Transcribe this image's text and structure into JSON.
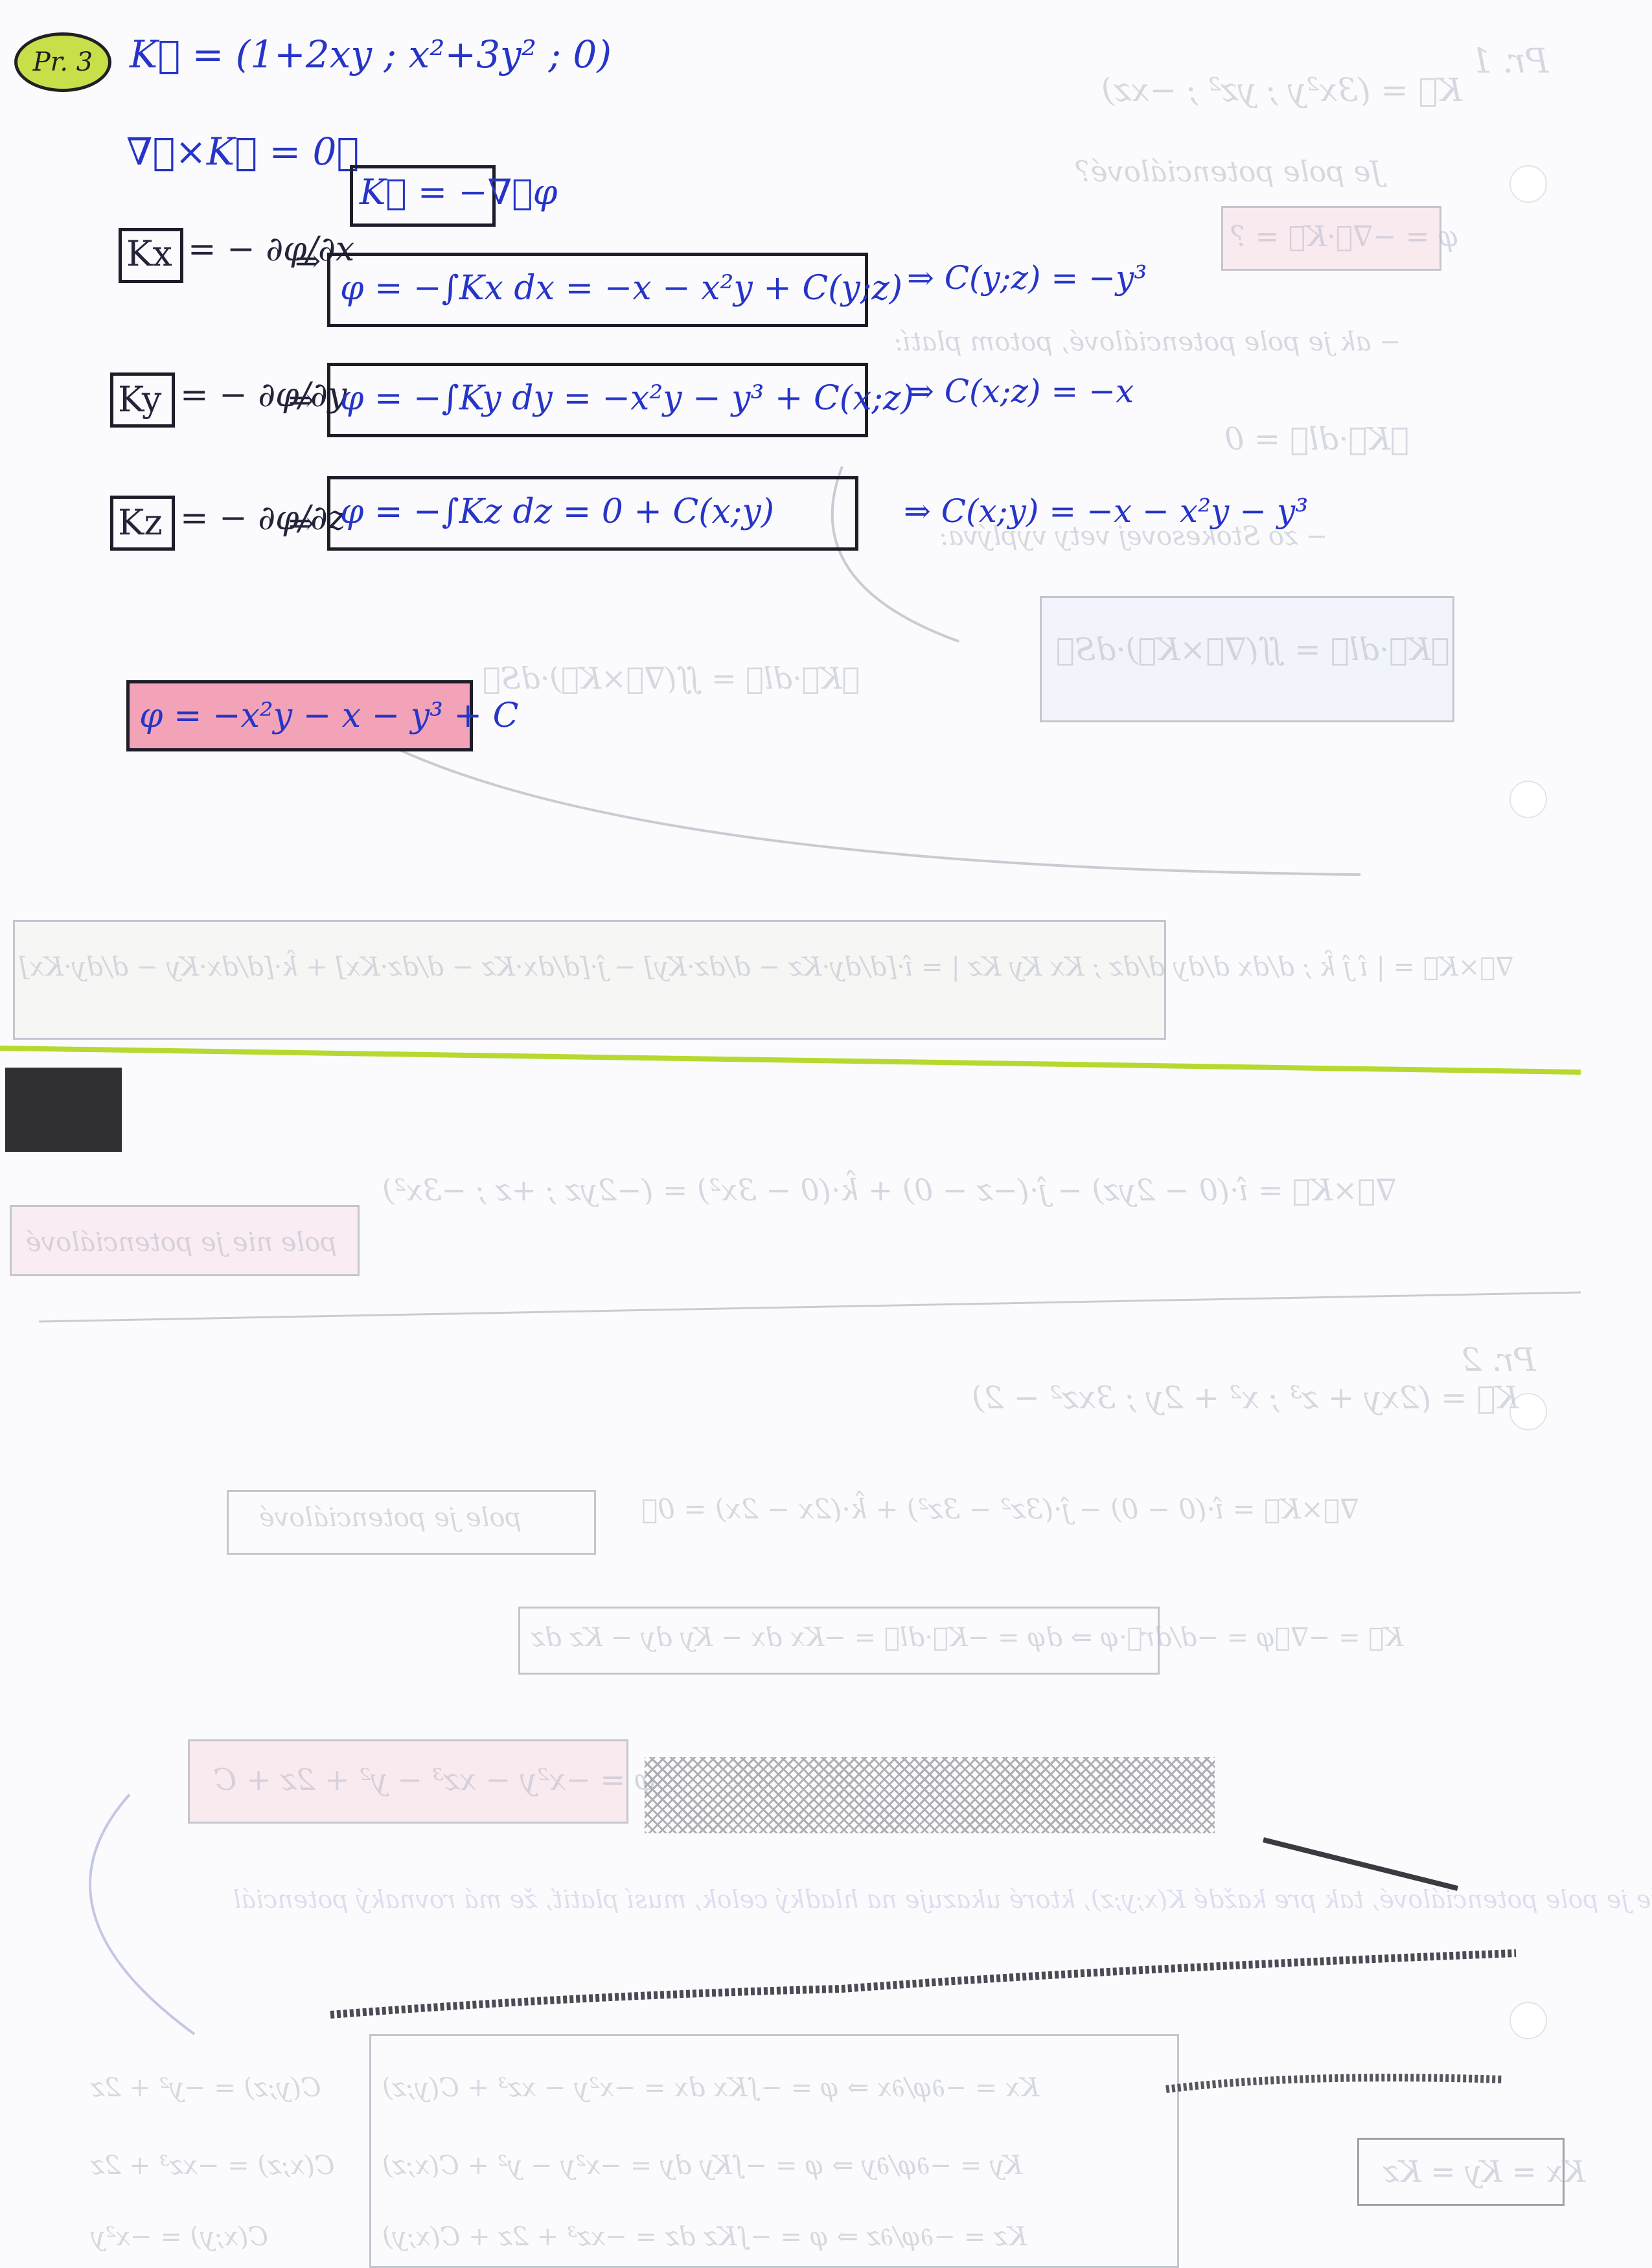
{
  "problem": {
    "tag": "Pr. 3",
    "field": "K⃗ = (1+2xy ; x²+3y² ; 0)",
    "curl_zero": "∇⃗×K⃗ = 0⃗",
    "potential_def": "K⃗ = −∇⃗φ",
    "rows": [
      {
        "component": "Kx",
        "derivative": "= − ∂φ/∂x",
        "arrow": "⇒",
        "integral": "φ = −∫Kx dx = −x − x²y + C(y;z)",
        "result": "⇒ C(y;z) = −y³"
      },
      {
        "component": "Ky",
        "derivative": "= − ∂φ/∂y",
        "arrow": "⇒",
        "integral": "φ = −∫Ky dy = −x²y − y³ + C(x;z)",
        "result": "⇒ C(x;z) = −x"
      },
      {
        "component": "Kz",
        "derivative": "= − ∂φ/∂z",
        "arrow": "⇒",
        "integral": "φ = −∫Kz dz = 0 + C(x;y)",
        "result": "⇒ C(x;y) = −x − x²y − y³"
      }
    ],
    "final": "φ = −x²y − x − y³ + C"
  },
  "bleed_through": {
    "tag_1": "Pr. 1",
    "field_1": "K⃗ = (3x²y ; yz² ; −xz)",
    "question_1": "Je pole potenciálové?",
    "answer_1": "φ = −∇⃗·K⃗ = ?",
    "note_1": "− ak je pole potenciálové, potom platí:",
    "circ": "∮K⃗·dl⃗ = 0",
    "stokes": "− zo Stokesovej vety vyplýva:",
    "stokes_formula": "∮K⃗·dl⃗ = ∬(∇⃗×K⃗)·dS⃗",
    "curl_det": "∇⃗×K⃗ = | î ĵ k̂ ; d/dx d/dy d/dz ; Kx Ky Kz | = î·[d/dy·Kz − d/dz·Ky] − ĵ·[d/dx·Kz − d/dz·Kx] + k̂·[d/dx·Ky − d/dy·Kx]",
    "curl_result": "∇⃗×K⃗ = î·(0 − 2yz) − ĵ·(−z − 0) + k̂·(0 − 3x²) = (−2yz ; +z ; −3x²)",
    "curl_note": "pole nie je potenciálové",
    "tag_2": "Pr. 2",
    "field_2": "K⃗ = (2xy + z³ ; x² + 2y ; 3xz² − 2)",
    "curl_2": "∇⃗×K⃗ = î·(0 − 0) − ĵ·(3z² − 3z²) + k̂·(2x − 2x) = 0⃗",
    "curl_2_note": "pole je potenciálové",
    "grad": "K⃗ = −∇⃗φ = −d/dr⃗·φ ⇒ dφ = −K⃗·dl⃗ = −Kx dx − Ky dy − Kz dz",
    "phi_2": "φ = −x²y − xz³ − y² + 2z + C",
    "note_2": "• Keďže je pole potenciálové, tak pre každé K(x;y;z), ktoré ukazuje na hladký celok, musí platiť, že má rovnaký potenciál",
    "rows_2": [
      "Kx = −∂φ/∂x ⇒ φ = −∫Kx dx = −x²y − xz³ + C(y;z)",
      "Ky = −∂φ/∂y ⇒ φ = −∫Ky dy = −x²y − y² + C(x;z)",
      "Kz = −∂φ/∂z ⇒ φ = −∫Kz dz = −xz³ + 2z + C(x;y)"
    ],
    "constants_2": [
      "C(y;z) = −y² + 2z",
      "C(x;z) = −xz³ + 2z",
      "C(x;y) = −x²y"
    ],
    "equal": "Kx = Ky = Kz"
  },
  "colors": {
    "ink_blue": "#2634c8",
    "ink_dark": "#1d1d2a",
    "tag_green": "#c8df4a",
    "highlight_pink": "#f2a3b8",
    "divider_green": "#b6d930",
    "ghost": "#b9bccb"
  }
}
